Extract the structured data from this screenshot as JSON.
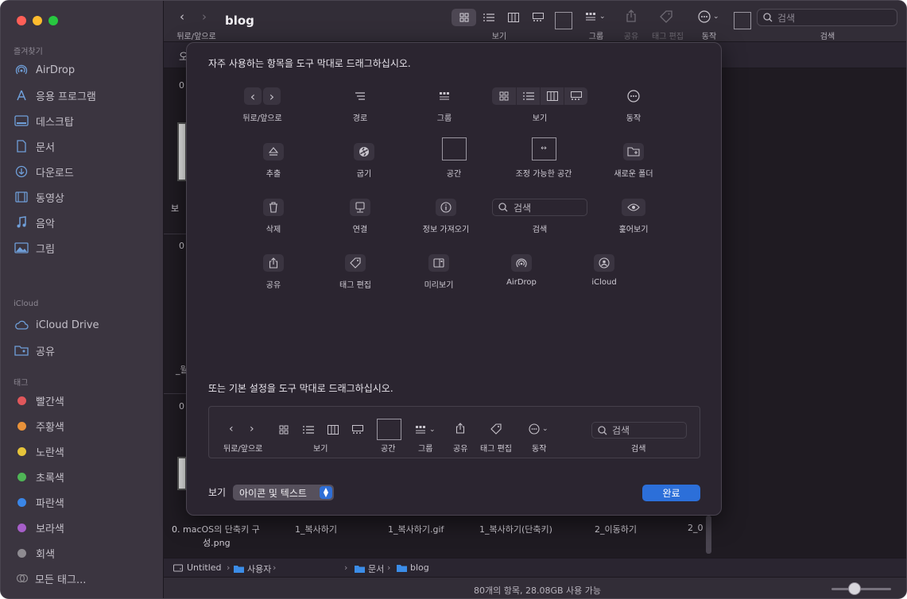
{
  "window": {
    "title": "blog"
  },
  "sidebar": {
    "favorites_header": "즐겨찾기",
    "favorites": [
      {
        "label": "AirDrop",
        "icon": "airdrop-icon"
      },
      {
        "label": "응용 프로그램",
        "icon": "applications-icon"
      },
      {
        "label": "데스크탑",
        "icon": "desktop-icon"
      },
      {
        "label": "문서",
        "icon": "document-icon"
      },
      {
        "label": "다운로드",
        "icon": "download-icon"
      },
      {
        "label": "동영상",
        "icon": "movie-icon"
      },
      {
        "label": "음악",
        "icon": "music-icon"
      },
      {
        "label": "그림",
        "icon": "picture-icon"
      }
    ],
    "icloud_header": "iCloud",
    "icloud": [
      {
        "label": "iCloud Drive",
        "icon": "cloud-icon"
      },
      {
        "label": "공유",
        "icon": "shared-folder-icon"
      }
    ],
    "tags_header": "태그",
    "tags": [
      {
        "label": "빨간색",
        "color": "#e0575b"
      },
      {
        "label": "주황색",
        "color": "#e8923a"
      },
      {
        "label": "노란색",
        "color": "#e6c43a"
      },
      {
        "label": "초록색",
        "color": "#4fb556"
      },
      {
        "label": "파란색",
        "color": "#3a86e8"
      },
      {
        "label": "보라색",
        "color": "#a65ec9"
      },
      {
        "label": "회색",
        "color": "#8e8b91"
      },
      {
        "label": "모든 태그...",
        "color": ""
      }
    ]
  },
  "toolbar": {
    "nav_label": "뒤로/앞으로",
    "view_label": "보기",
    "group_label": "그룹",
    "share_label": "공유",
    "tag_label": "태그 편집",
    "action_label": "동작",
    "search_label": "검색",
    "search_placeholder": "검색"
  },
  "background": {
    "peek_texts": [
      "오",
      "0",
      "보",
      "0",
      "_월",
      "0"
    ],
    "bottom_files": [
      "0. macOS의 단축키 구",
      "성.png",
      "1_복사하기",
      "1_복사하기.gif",
      "1_복사하기(단축키)",
      "2_이동하기",
      "2_0"
    ]
  },
  "pathbar": {
    "segments": [
      "Untitled",
      "사용자",
      "문서",
      "blog"
    ]
  },
  "statusbar": {
    "text": "80개의 항목, 28.08GB 사용 가능",
    "zoom_fraction": 0.35
  },
  "sheet": {
    "title": "자주 사용하는 항목을 도구 막대로 드래그하십시오.",
    "items": [
      {
        "label": "뒤로/앞으로",
        "icon": "back-forward-icon"
      },
      {
        "label": "경로",
        "icon": "path-icon"
      },
      {
        "label": "그룹",
        "icon": "group-icon"
      },
      {
        "label": "보기",
        "icon": "view-icon"
      },
      {
        "label": "동작",
        "icon": "action-icon"
      },
      {
        "label": "추출",
        "icon": "eject-icon"
      },
      {
        "label": "굽기",
        "icon": "burn-icon"
      },
      {
        "label": "공간",
        "icon": "space-icon"
      },
      {
        "label": "조정 가능한 공간",
        "icon": "flexible-space-icon"
      },
      {
        "label": "새로운 폴더",
        "icon": "new-folder-icon"
      },
      {
        "label": "삭제",
        "icon": "trash-icon"
      },
      {
        "label": "연결",
        "icon": "connect-icon"
      },
      {
        "label": "정보 가져오기",
        "icon": "info-icon"
      },
      {
        "label": "검색",
        "icon": "search-icon",
        "placeholder": "검색"
      },
      {
        "label": "훑어보기",
        "icon": "quicklook-icon"
      },
      {
        "label": "공유",
        "icon": "share-icon"
      },
      {
        "label": "태그 편집",
        "icon": "tag-icon"
      },
      {
        "label": "미리보기",
        "icon": "preview-icon"
      },
      {
        "label": "AirDrop",
        "icon": "airdrop-icon"
      },
      {
        "label": "iCloud",
        "icon": "icloud-icon"
      }
    ],
    "default_title": "또는 기본 설정을 도구 막대로 드래그하십시오.",
    "default_set": {
      "nav": "뒤로/앞으로",
      "view": "보기",
      "space": "공간",
      "group": "그룹",
      "share": "공유",
      "tag": "태그 편집",
      "action": "동작",
      "search": "검색",
      "search_placeholder": "검색"
    },
    "show_label": "보기",
    "show_value": "아이콘 및 텍스트",
    "done_label": "완료"
  },
  "colors": {
    "accent": "#2c6fd9",
    "sidebar_icon": "#6f9fd9"
  }
}
